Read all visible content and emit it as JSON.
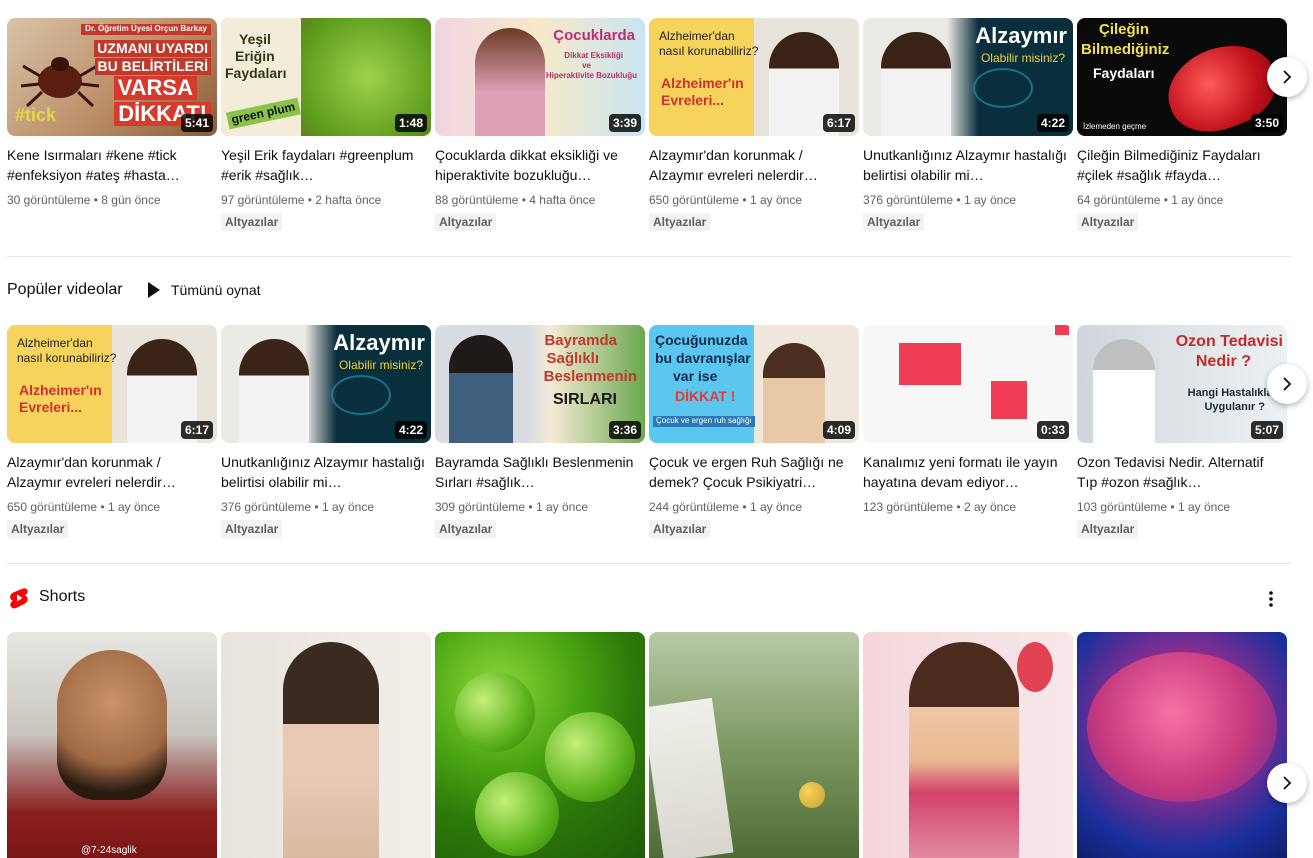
{
  "row1": [
    {
      "thumb_text": [
        "UZMANI UYARDI",
        "BU BELİRTİLERİ",
        "VARSA",
        "DİKKAT!"
      ],
      "thumb_top": "Dr. Öğretim Üyesi Orçun Barkay",
      "thumb_tag": "#tick",
      "duration": "5:41",
      "title": "Kene Isırmaları #kene #tick #enfeksiyon #ateş #hasta…",
      "views": "30 görüntüleme",
      "age": "8 gün önce",
      "badge": ""
    },
    {
      "thumb_text": [
        "Yeşil",
        "Eriğin",
        "Faydaları"
      ],
      "thumb_tag": "green plum",
      "duration": "1:48",
      "title": "Yeşil Erik faydaları #greenplum #erik #sağlık…",
      "views": "97 görüntüleme",
      "age": "2 hafta önce",
      "badge": "Altyazılar"
    },
    {
      "thumb_text": [
        "Çocuklarda"
      ],
      "thumb_sub": [
        "Dikkat Eksikliği",
        "ve",
        "Hiperaktivite Bozukluğu"
      ],
      "duration": "3:39",
      "title": "Çocuklarda dikkat eksikliği ve hiperaktivite bozukluğu…",
      "views": "88 görüntüleme",
      "age": "4 hafta önce",
      "badge": "Altyazılar"
    },
    {
      "thumb_text": [
        "Alzheimer'dan",
        "nasıl korunabiliriz?"
      ],
      "thumb_sub": [
        "Alzheimer'ın",
        "Evreleri..."
      ],
      "duration": "6:17",
      "title": "Alzaymır'dan korunmak / Alzaymır evreleri nelerdir…",
      "views": "650 görüntüleme",
      "age": "1 ay önce",
      "badge": "Altyazılar"
    },
    {
      "thumb_text": [
        "Alzaymır"
      ],
      "thumb_sub": [
        "Olabilir misiniz?"
      ],
      "duration": "4:22",
      "title": "Unutkanlığınız Alzaymır hastalığı belirtisi olabilir mi…",
      "views": "376 görüntüleme",
      "age": "1 ay önce",
      "badge": "Altyazılar"
    },
    {
      "thumb_text": [
        "Çileğin",
        "Bilmediğiniz",
        "Faydaları"
      ],
      "thumb_tag": "İzlemeden geçme",
      "duration": "3:50",
      "title": "Çileğin Bilmediğiniz Faydaları #çilek #sağlık #fayda…",
      "views": "64 görüntüleme",
      "age": "1 ay önce",
      "badge": "Altyazılar"
    }
  ],
  "popular": {
    "heading": "Popüler videolar",
    "play_all": "Tümünü oynat",
    "items": [
      {
        "thumb_text": [
          "Alzheimer'dan",
          "nasıl korunabiliriz?"
        ],
        "thumb_sub": [
          "Alzheimer'ın",
          "Evreleri..."
        ],
        "duration": "6:17",
        "title": "Alzaymır'dan korunmak / Alzaymır evreleri nelerdir…",
        "views": "650 görüntüleme",
        "age": "1 ay önce",
        "badge": "Altyazılar"
      },
      {
        "thumb_text": [
          "Alzaymır"
        ],
        "thumb_sub": [
          "Olabilir misiniz?"
        ],
        "duration": "4:22",
        "title": "Unutkanlığınız Alzaymır hastalığı belirtisi olabilir mi…",
        "views": "376 görüntüleme",
        "age": "1 ay önce",
        "badge": "Altyazılar"
      },
      {
        "thumb_text": [
          "Bayramda",
          "Sağlıklı",
          "Beslenmenin"
        ],
        "thumb_sub": [
          "SIRLARI"
        ],
        "duration": "3:36",
        "title": "Bayramda Sağlıklı Beslenmenin Sırları #sağlık…",
        "views": "309 görüntüleme",
        "age": "1 ay önce",
        "badge": "Altyazılar"
      },
      {
        "thumb_text": [
          "Çocuğunuzda",
          "bu davranışlar",
          "var ise"
        ],
        "thumb_sub": [
          "DİKKAT !"
        ],
        "thumb_tag": "Çocuk ve ergen ruh sağlığı",
        "duration": "4:09",
        "title": "Çocuk ve ergen Ruh Sağlığı ne demek? Çocuk Psikiyatri…",
        "views": "244 görüntüleme",
        "age": "1 ay önce",
        "badge": "Altyazılar"
      },
      {
        "thumb_text": [],
        "duration": "0:33",
        "title": "Kanalımız yeni formatı ile yayın hayatına devam ediyor…",
        "views": "123 görüntüleme",
        "age": "2 ay önce",
        "badge": ""
      },
      {
        "thumb_text": [
          "Ozon Tedavisi",
          "Nedir ?"
        ],
        "thumb_sub": [
          "Hangi Hastalıklara",
          "Uygulanır ?"
        ],
        "duration": "5:07",
        "title": "Ozon Tedavisi Nedir. Alternatif Tıp #ozon #sağlık…",
        "views": "103 görüntüleme",
        "age": "1 ay önce",
        "badge": "Altyazılar"
      }
    ]
  },
  "shorts": {
    "heading": "Shorts",
    "watermark": "@7-24saglik"
  },
  "colors": {
    "accent": "#ff0000",
    "meta": "#606060"
  }
}
